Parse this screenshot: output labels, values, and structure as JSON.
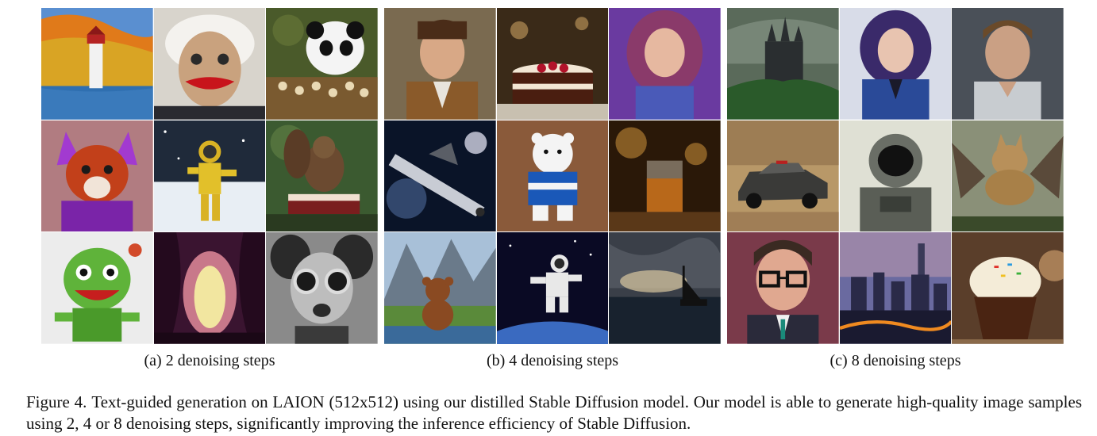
{
  "figure": {
    "label": "Figure 4.",
    "caption": "Text-guided generation on LAION (512x512) using our distilled Stable Diffusion model. Our model is able to generate high-quality image samples using 2, 4 or 8 denoising steps, significantly improving the inference efficiency of Stable Diffusion."
  },
  "panels": [
    {
      "caption": "(a) 2 denoising steps",
      "tiles": [
        "lighthouse",
        "knitted-einstein",
        "panda-chess",
        "purple-fox",
        "astronaut-snow",
        "squirrel-cake",
        "green-plush-monster",
        "purple-forest-cave",
        "mouse-goggles"
      ]
    },
    {
      "caption": "(b) 4 denoising steps",
      "tiles": [
        "man-portrait",
        "cake",
        "woman-portrait",
        "spaceship",
        "polar-bear-sweater",
        "whiskey-glass",
        "teddy-bear-mountains",
        "astronaut-space",
        "ship-storm"
      ]
    },
    {
      "caption": "(c) 8 denoising steps",
      "tiles": [
        "castle",
        "woman-blue-jacket",
        "man-portrait-beard",
        "police-car",
        "astronaut-helmet",
        "winged-wolf",
        "man-glasses",
        "city-night",
        "cupcake"
      ]
    }
  ],
  "colors": {
    "text": "#111111",
    "background": "#ffffff"
  }
}
